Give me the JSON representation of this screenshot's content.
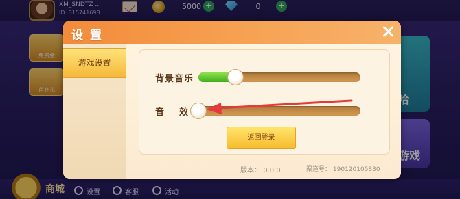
{
  "lobby": {
    "username": "XM_SNDTZ ...",
    "user_id": "ID: 315741698",
    "coins": "5000",
    "gems": "0",
    "side_cards": [
      "免费金",
      "首充礼"
    ],
    "right_cards": [
      "哈",
      "游戏"
    ],
    "bottom": {
      "mall": "商城",
      "settings": "设置",
      "service": "客服",
      "activity": "活动"
    }
  },
  "dialog": {
    "title": "设 置",
    "tab_game_settings": "游戏设置",
    "bgm_label": "背景音乐",
    "sfx_label_1": "音",
    "sfx_label_2": "效",
    "bgm_level": 0.23,
    "sfx_level": 0.0,
    "return_button": "返回登录",
    "version_label": "版本：",
    "version_value": "0.0.0",
    "channel_label": "渠道号：",
    "channel_value": "190120105830"
  },
  "colors": {
    "header": "#f28b3a",
    "slider_fill": "#3fae1c",
    "annotation_arrow": "#e63a3a"
  }
}
